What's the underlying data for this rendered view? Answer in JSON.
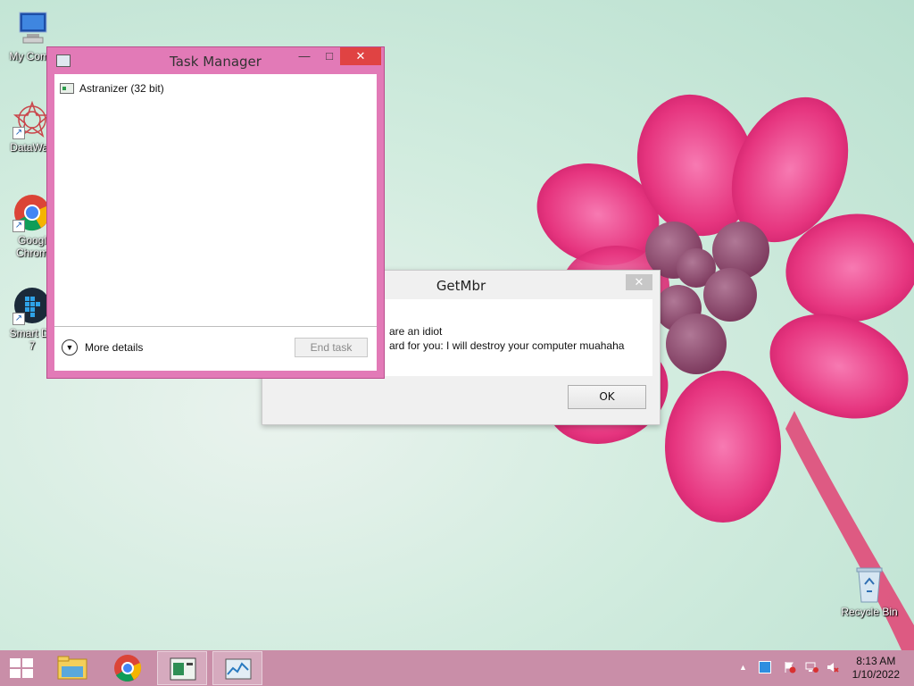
{
  "desktop": {
    "icons": [
      {
        "label": "My Comp",
        "icon": "computer-icon"
      },
      {
        "label": "DataWag",
        "icon": "datawag-icon"
      },
      {
        "label": "Googl\nChrom",
        "icon": "chrome-icon"
      },
      {
        "label": "Smart De\n7",
        "icon": "smart-icon"
      },
      {
        "label": "Recycle Bin",
        "icon": "recycle-bin-icon"
      }
    ]
  },
  "getmbr": {
    "title": "GetMbr",
    "close_symbol": "✕",
    "line1": "are an idiot",
    "line2": "ard for you: I will destroy your computer muahaha",
    "ok_label": "OK"
  },
  "taskmanager": {
    "title": "Task Manager",
    "min_symbol": "—",
    "max_symbol": "□",
    "close_symbol": "✕",
    "processes": [
      {
        "name": "Astranizer (32 bit)"
      }
    ],
    "more_details": "More details",
    "end_task": "End task"
  },
  "taskbar": {
    "buttons": [
      "start-button",
      "file-explorer",
      "chrome",
      "app-window",
      "task-manager"
    ],
    "clock_time": "8:13 AM",
    "clock_date": "1/10/2022",
    "tray_icons": [
      "show-hidden-icons",
      "network-icon",
      "action-center-flag-icon",
      "network-alert-icon",
      "volume-muted-icon"
    ]
  },
  "colors": {
    "taskbar": "#c98ea8",
    "window_frame": "#e27ab7",
    "close_red": "#e04343",
    "flower_pink": "#e6357f"
  }
}
